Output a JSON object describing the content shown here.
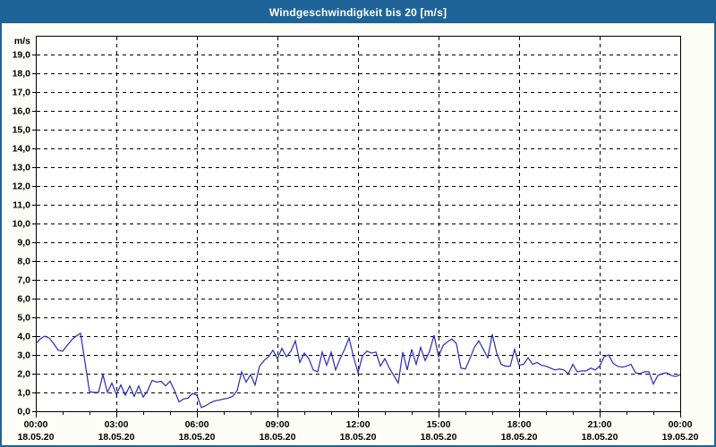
{
  "window": {
    "title": "Windgeschwindigkeit bis 20 [m/s]"
  },
  "colors": {
    "title_bar_bg": "#1e6498",
    "title_text": "#ffffff",
    "window_border": "#1e6498",
    "window_bg": "#fcfdf6",
    "plot_bg": "#ffffff",
    "axis_color": "#000000",
    "line_color": "#2929b8"
  },
  "chart_data": {
    "type": "line",
    "title": "Windgeschwindigkeit bis 20 [m/s]",
    "unit_label": "m/s",
    "ylabel": "m/s",
    "ylim": [
      0,
      20
    ],
    "y_tick_step": 1,
    "y_tick_labels": [
      "0,0",
      "1,0",
      "2,0",
      "3,0",
      "4,0",
      "5,0",
      "6,0",
      "7,0",
      "8,0",
      "9,0",
      "10,0",
      "11,0",
      "12,0",
      "13,0",
      "14,0",
      "15,0",
      "16,0",
      "17,0",
      "18,0",
      "19,0"
    ],
    "grid": "dashed",
    "legend": "none",
    "x_interval_minutes": 10,
    "x_minor_tick_every_hours": 1,
    "x_major_tick_every_hours": 3,
    "x_major_ticks": [
      {
        "time": "00:00",
        "date": "18.05.20"
      },
      {
        "time": "03:00",
        "date": "18.05.20"
      },
      {
        "time": "06:00",
        "date": "18.05.20"
      },
      {
        "time": "09:00",
        "date": "18.05.20"
      },
      {
        "time": "12:00",
        "date": "18.05.20"
      },
      {
        "time": "15:00",
        "date": "18.05.20"
      },
      {
        "time": "18:00",
        "date": "18.05.20"
      },
      {
        "time": "21:00",
        "date": "18.05.20"
      },
      {
        "time": "00:00",
        "date": "19.05.20"
      }
    ],
    "values": [
      3.6,
      3.85,
      4.0,
      3.9,
      3.6,
      3.25,
      3.2,
      3.5,
      3.8,
      4.0,
      4.15,
      2.6,
      1.05,
      1.0,
      1.0,
      1.95,
      1.0,
      1.5,
      0.9,
      1.4,
      0.85,
      1.35,
      0.8,
      1.35,
      0.75,
      1.1,
      1.65,
      1.55,
      1.6,
      1.35,
      1.6,
      1.1,
      0.5,
      0.65,
      0.7,
      0.95,
      0.85,
      0.2,
      0.3,
      0.45,
      0.55,
      0.6,
      0.65,
      0.7,
      0.8,
      1.1,
      2.1,
      1.55,
      1.95,
      1.4,
      2.4,
      2.7,
      2.9,
      3.25,
      2.8,
      3.35,
      2.9,
      3.2,
      3.75,
      2.6,
      3.1,
      2.8,
      2.2,
      2.1,
      3.15,
      2.45,
      3.15,
      2.2,
      2.8,
      3.3,
      3.9,
      2.9,
      2.05,
      2.95,
      3.2,
      3.1,
      3.15,
      2.4,
      2.8,
      2.3,
      1.9,
      1.5,
      3.15,
      2.2,
      3.3,
      2.5,
      3.4,
      2.7,
      3.2,
      4.05,
      2.9,
      3.5,
      3.7,
      3.85,
      3.6,
      2.3,
      2.25,
      2.8,
      3.4,
      3.75,
      3.3,
      2.85,
      4.1,
      3.1,
      2.5,
      2.4,
      2.4,
      3.3,
      2.45,
      2.5,
      2.85,
      2.5,
      2.6,
      2.45,
      2.4,
      2.3,
      2.2,
      2.25,
      2.2,
      2.0,
      2.5,
      2.1,
      2.15,
      2.15,
      2.3,
      2.2,
      2.4,
      2.9,
      3.0,
      2.55,
      2.4,
      2.35,
      2.4,
      2.5,
      2.05,
      2.0,
      2.1,
      2.1,
      1.45,
      1.9,
      2.0,
      2.05,
      1.9,
      1.85,
      1.95
    ]
  }
}
